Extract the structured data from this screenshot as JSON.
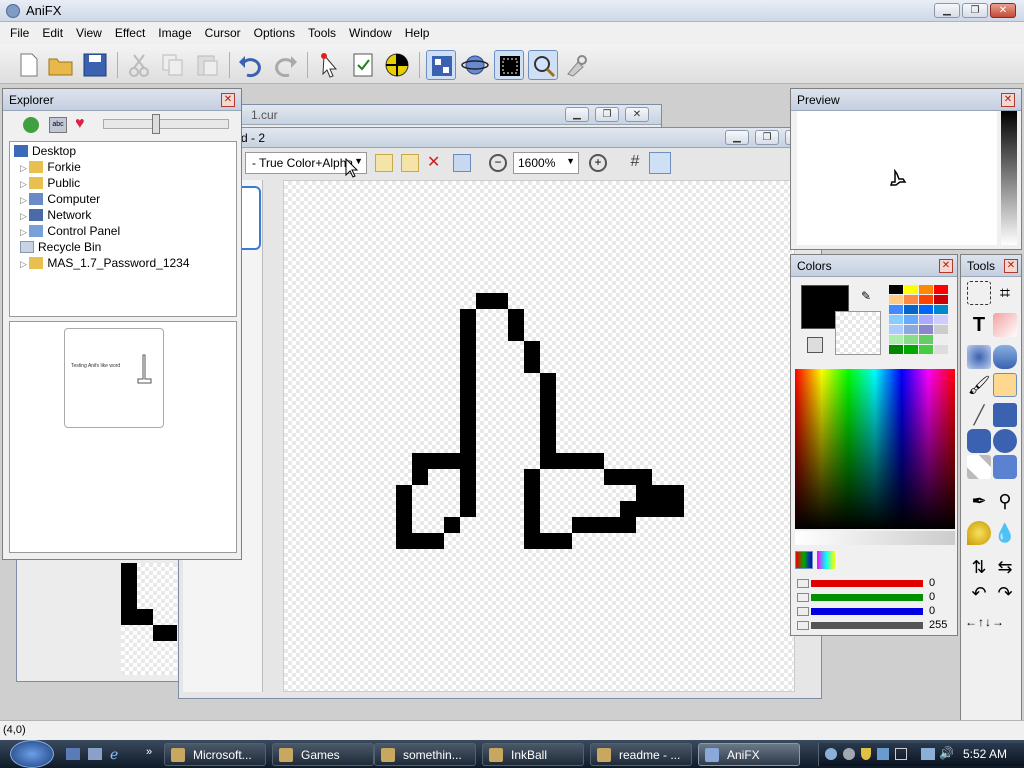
{
  "app": {
    "title": "AniFX"
  },
  "menu": [
    "File",
    "Edit",
    "View",
    "Effect",
    "Image",
    "Cursor",
    "Options",
    "Tools",
    "Window",
    "Help"
  ],
  "back_doc": {
    "title_fragment": "1.cur"
  },
  "doc": {
    "title_fragment": "d - 2",
    "color_mode": "- True Color+Alpha",
    "zoom": "1600%"
  },
  "explorer": {
    "title": "Explorer",
    "tree": [
      {
        "label": "Desktop",
        "icon": "desktop-icon",
        "root": true
      },
      {
        "label": "Forkie",
        "icon": "folder-icon"
      },
      {
        "label": "Public",
        "icon": "folder-icon"
      },
      {
        "label": "Computer",
        "icon": "computer-icon"
      },
      {
        "label": "Network",
        "icon": "network-icon"
      },
      {
        "label": "Control Panel",
        "icon": "control-panel-icon"
      },
      {
        "label": "Recycle Bin",
        "icon": "recycle-bin-icon"
      },
      {
        "label": "MAS_1.7_Password_1234",
        "icon": "folder-icon"
      }
    ],
    "thumb_text": "Testing Anifx like word"
  },
  "preview": {
    "title": "Preview"
  },
  "colors": {
    "title": "Colors",
    "channels": [
      {
        "name": "red",
        "value": "0",
        "color": "#e00000"
      },
      {
        "name": "green",
        "value": "0",
        "color": "#009000"
      },
      {
        "name": "blue",
        "value": "0",
        "color": "#0000e0"
      },
      {
        "name": "alpha",
        "value": "255",
        "color": "#555555"
      }
    ],
    "primary": "#000000"
  },
  "tools": {
    "title": "Tools"
  },
  "status": {
    "coords": "(4,0)"
  },
  "taskbar": {
    "tasks": [
      {
        "label": "Microsoft...",
        "icon": "explorer-icon"
      },
      {
        "label": "Games",
        "icon": "games-icon"
      },
      {
        "label": "somethin...",
        "icon": "notepad-icon"
      },
      {
        "label": "InkBall",
        "icon": "inkball-icon"
      },
      {
        "label": "readme - ...",
        "icon": "notepad-icon"
      },
      {
        "label": "AniFX",
        "icon": "anifx-icon",
        "active": true
      }
    ],
    "clock": "5:52 AM"
  }
}
